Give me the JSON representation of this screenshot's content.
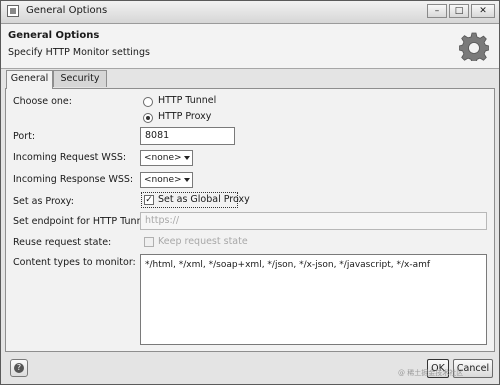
{
  "window": {
    "title": "General Options"
  },
  "header": {
    "title": "General Options",
    "subtitle": "Specify HTTP Monitor settings",
    "icon": "gear-icon"
  },
  "tabs": [
    {
      "label": "General",
      "selected": true
    },
    {
      "label": "Security",
      "selected": false
    }
  ],
  "form": {
    "choose_one": {
      "label": "Choose one:",
      "options": [
        {
          "label": "HTTP Tunnel",
          "selected": false
        },
        {
          "label": "HTTP Proxy",
          "selected": true
        }
      ]
    },
    "port": {
      "label": "Port:",
      "value": "8081"
    },
    "incoming_request_wss": {
      "label": "Incoming Request WSS:",
      "value": "<none>"
    },
    "incoming_response_wss": {
      "label": "Incoming Response WSS:",
      "value": "<none>"
    },
    "set_as_proxy": {
      "label": "Set as Proxy:",
      "checkbox_label": "Set as Global Proxy",
      "checked": true
    },
    "endpoint": {
      "label": "Set endpoint for HTTP Tunnel:",
      "placeholder": "https://",
      "enabled": false
    },
    "reuse_request_state": {
      "label": "Reuse request state:",
      "checkbox_label": "Keep request state",
      "checked": false,
      "enabled": false
    },
    "content_types": {
      "label": "Content types to monitor:",
      "value": "*/html, */xml, */soap+xml, */json, */x-json, */javascript, */x-amf"
    }
  },
  "footer": {
    "help_icon": "help-icon",
    "ok_label": "OK",
    "cancel_label": "Cancel"
  },
  "watermark": "@ 稀土掘金技术社区"
}
